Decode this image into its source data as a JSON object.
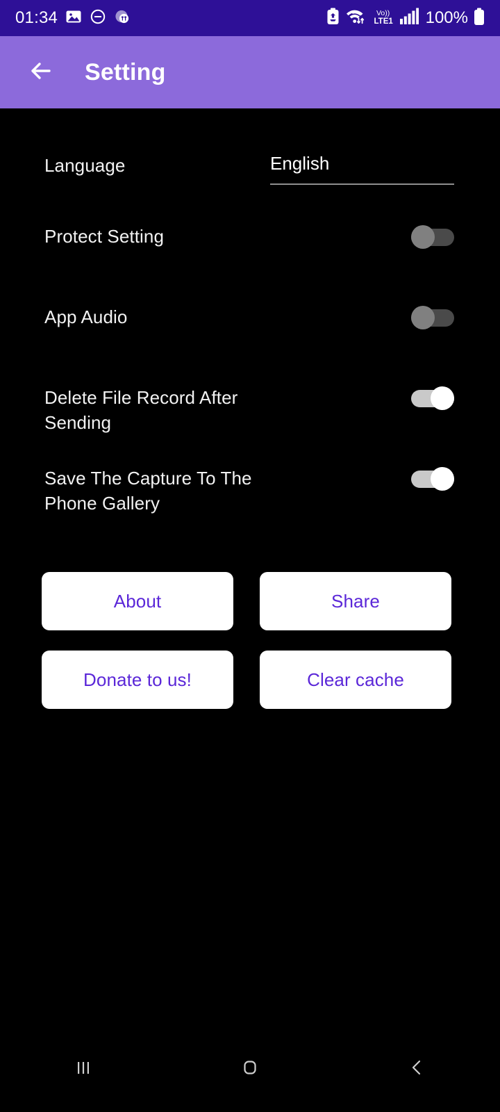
{
  "status_bar": {
    "clock": "01:34",
    "battery_percent": "100%",
    "network_label": "LTE1",
    "volte_label": "Vo))",
    "icons": [
      "photo-icon",
      "do-not-disturb-icon",
      "coin-transfer-icon",
      "battery-saver-icon",
      "wifi-data-icon",
      "volte-icon",
      "signal-bars-icon",
      "battery-icon"
    ],
    "colors": {
      "background": "#2E1097",
      "foreground": "#FFFFFF"
    }
  },
  "app_bar": {
    "title": "Setting",
    "back_icon": "arrow-left-icon",
    "colors": {
      "background": "#8C6ADB",
      "foreground": "#FFFFFF"
    }
  },
  "settings": {
    "language": {
      "label": "Language",
      "value": "English",
      "options": [
        "English"
      ]
    },
    "toggles": [
      {
        "label": "Protect Setting",
        "state": "off"
      },
      {
        "label": "App Audio",
        "state": "off"
      },
      {
        "label": "Delete File Record After Sending",
        "state": "on"
      },
      {
        "label": "Save The Capture To The Phone Gallery",
        "state": "on"
      }
    ]
  },
  "buttons": [
    {
      "label": "About"
    },
    {
      "label": "Share"
    },
    {
      "label": "Donate to us!"
    },
    {
      "label": "Clear cache"
    }
  ],
  "nav_bar": {
    "recents_icon": "recents-icon",
    "home_icon": "home-icon",
    "back_icon": "back-chevron-icon"
  },
  "theme": {
    "background": "#000000",
    "accent_purple": "#8C6ADB",
    "button_text": "#5B27D8",
    "status_bar_purple": "#2E1097"
  }
}
